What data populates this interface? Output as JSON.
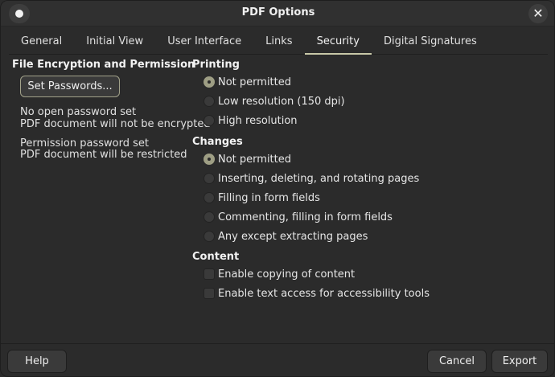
{
  "window": {
    "title": "PDF Options"
  },
  "tabs": [
    {
      "label": "General",
      "active": false
    },
    {
      "label": "Initial View",
      "active": false
    },
    {
      "label": "User Interface",
      "active": false
    },
    {
      "label": "Links",
      "active": false
    },
    {
      "label": "Security",
      "active": true
    },
    {
      "label": "Digital Signatures",
      "active": false
    }
  ],
  "encryption": {
    "title": "File Encryption and Permission",
    "set_passwords_label": "Set Passwords...",
    "open_password_line1": "No open password set",
    "open_password_line2": "PDF document will not be encrypted",
    "permission_password_line1": "Permission password set",
    "permission_password_line2": "PDF document will be restricted"
  },
  "printing": {
    "title": "Printing",
    "options": [
      {
        "label": "Not permitted",
        "checked": true
      },
      {
        "label": "Low resolution (150 dpi)",
        "checked": false
      },
      {
        "label": "High resolution",
        "checked": false
      }
    ]
  },
  "changes": {
    "title": "Changes",
    "options": [
      {
        "label": "Not permitted",
        "checked": true
      },
      {
        "label": "Inserting, deleting, and rotating pages",
        "checked": false
      },
      {
        "label": "Filling in form fields",
        "checked": false
      },
      {
        "label": "Commenting, filling in form fields",
        "checked": false
      },
      {
        "label": "Any except extracting pages",
        "checked": false
      }
    ]
  },
  "content_section": {
    "title": "Content",
    "options": [
      {
        "label": "Enable copying of content",
        "checked": false
      },
      {
        "label": "Enable text access for accessibility tools",
        "checked": false
      }
    ]
  },
  "footer": {
    "help_label": "Help",
    "cancel_label": "Cancel",
    "export_label": "Export"
  },
  "colors": {
    "background": "#2b2b2b",
    "accent": "#9e9e84",
    "text": "#e6e6e6"
  }
}
